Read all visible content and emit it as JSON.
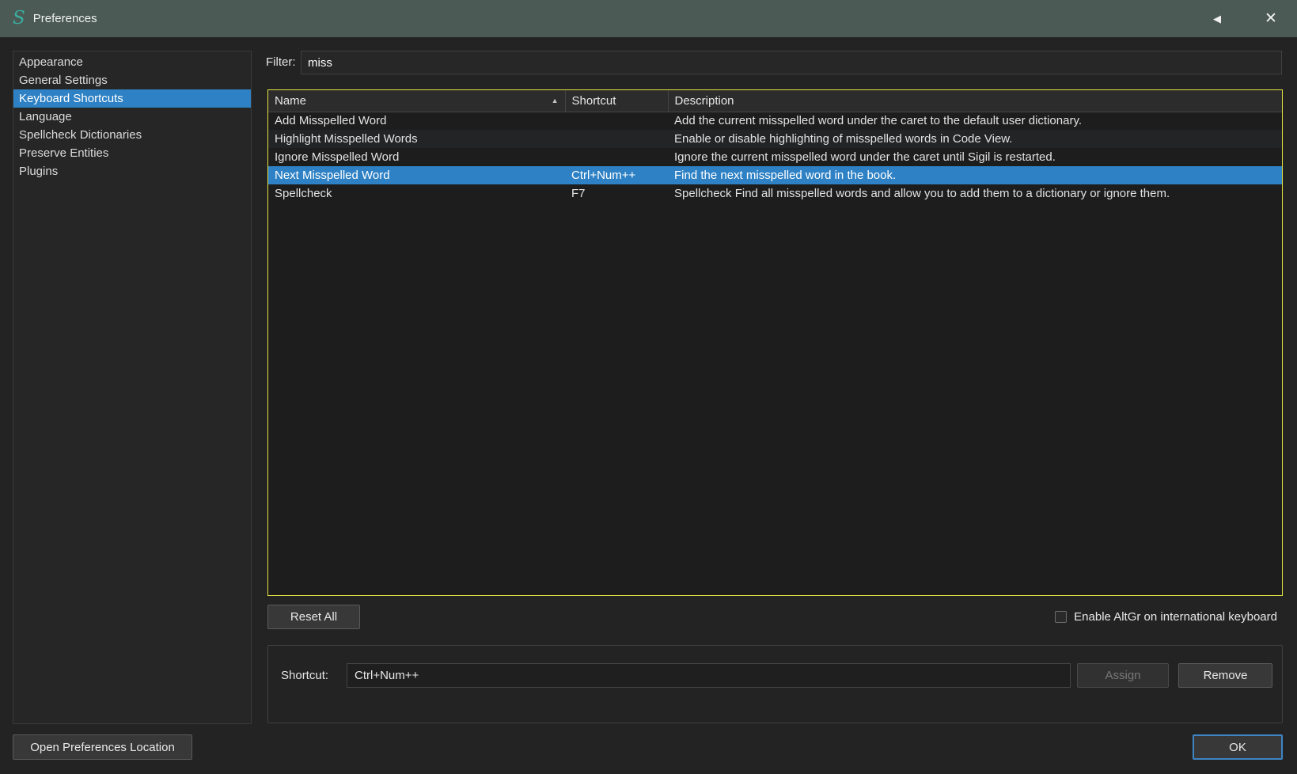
{
  "window": {
    "title": "Preferences",
    "logo_glyph": "S",
    "shade_glyph": "◀",
    "close_glyph": "✕"
  },
  "sidebar": {
    "items": [
      {
        "label": "Appearance",
        "selected": false
      },
      {
        "label": "General Settings",
        "selected": false
      },
      {
        "label": "Keyboard Shortcuts",
        "selected": true
      },
      {
        "label": "Language",
        "selected": false
      },
      {
        "label": "Spellcheck Dictionaries",
        "selected": false
      },
      {
        "label": "Preserve Entities",
        "selected": false
      },
      {
        "label": "Plugins",
        "selected": false
      }
    ]
  },
  "filter": {
    "label": "Filter:",
    "value": "miss"
  },
  "table": {
    "columns": [
      "Name",
      "Shortcut",
      "Description"
    ],
    "sort_column": "Name",
    "sort_direction": "ascending",
    "sort_glyph": "▲",
    "rows": [
      {
        "name": "Add Misspelled Word",
        "shortcut": "",
        "description": "Add the current misspelled word under the caret to the default user dictionary.",
        "selected": false
      },
      {
        "name": "Highlight Misspelled Words",
        "shortcut": "",
        "description": "Enable or disable highlighting of misspelled words in Code View.",
        "selected": false
      },
      {
        "name": "Ignore Misspelled Word",
        "shortcut": "",
        "description": "Ignore the current misspelled word under the caret until Sigil is restarted.",
        "selected": false
      },
      {
        "name": "Next Misspelled Word",
        "shortcut": "Ctrl+Num++",
        "description": "Find the next misspelled word in the book.",
        "selected": true
      },
      {
        "name": "Spellcheck",
        "shortcut": "F7",
        "description": "Spellcheck Find all misspelled words and allow you to add them to a dictionary or ignore them.",
        "selected": false
      }
    ]
  },
  "actions": {
    "reset_all_label": "Reset All",
    "altgr_label": "Enable AltGr on international keyboard",
    "altgr_checked": false
  },
  "shortcut_editor": {
    "label": "Shortcut:",
    "value": "Ctrl+Num++",
    "assign_label": "Assign",
    "assign_enabled": false,
    "remove_label": "Remove"
  },
  "footer": {
    "open_prefs_label": "Open Preferences Location",
    "ok_label": "OK"
  },
  "colors": {
    "titlebar_bg": "#4b5a54",
    "accent": "#2e81c4",
    "focus_ring": "#e3e345",
    "ok_border": "#3f85c4"
  }
}
